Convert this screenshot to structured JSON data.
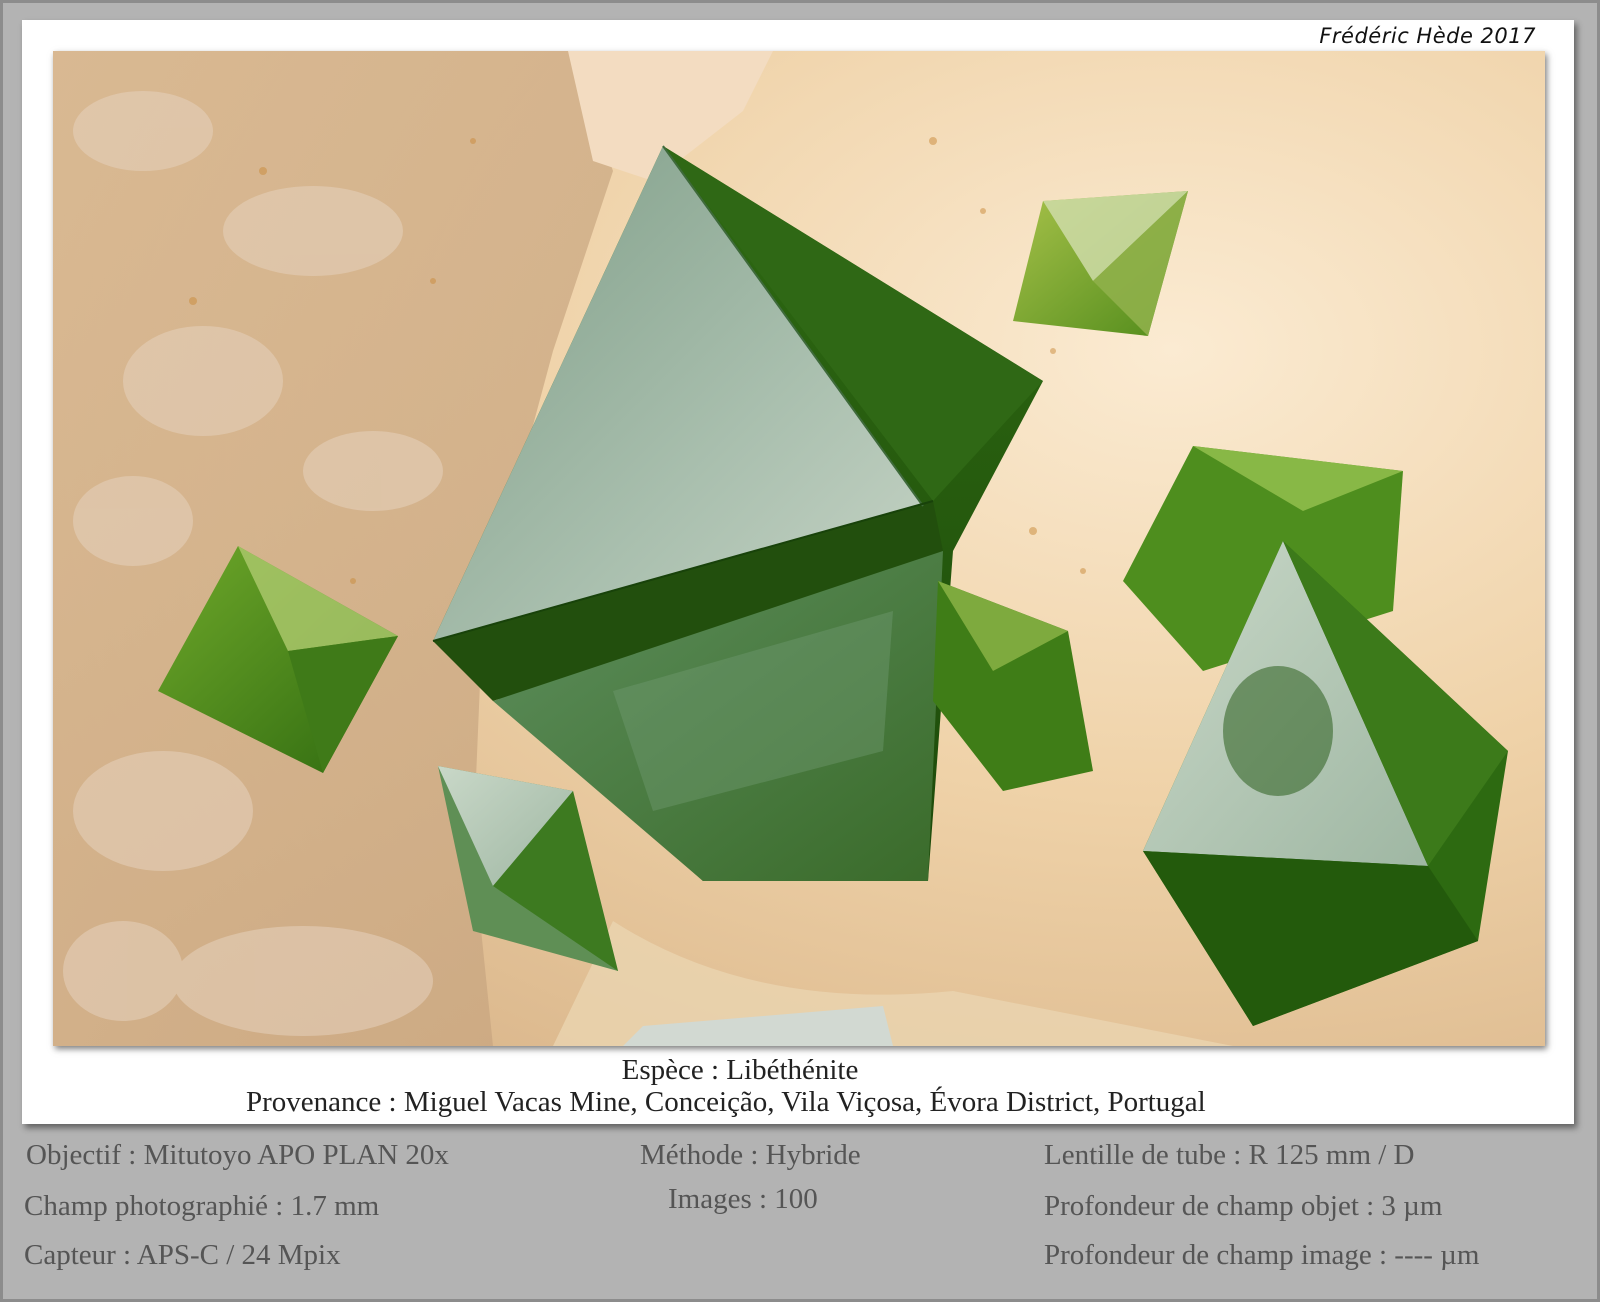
{
  "credit": "Frédéric Hède 2017",
  "specimen": {
    "species": "Espèce : Libéthénite",
    "provenance": "Provenance : Miguel Vacas Mine, Conceição, Vila Viçosa, Évora District, Portugal"
  },
  "shooting_info": {
    "objective": "Objectif : Mitutoyo APO PLAN 20x",
    "field": "Champ photographié : 1.7 mm",
    "sensor": "Capteur : APS-C / 24 Mpix",
    "method": "Méthode : Hybride",
    "images": "Images : 100",
    "tube_lens": "Lentille de tube : R 125 mm / D",
    "object_dof": "Profondeur de champ objet : 3 µm",
    "image_dof": "Profondeur de champ image : ---- µm"
  },
  "colors": {
    "background": "#b3b3b3",
    "card": "#ffffff",
    "crystal_green": "#3e7a1e",
    "matrix": "#eccfa6"
  }
}
